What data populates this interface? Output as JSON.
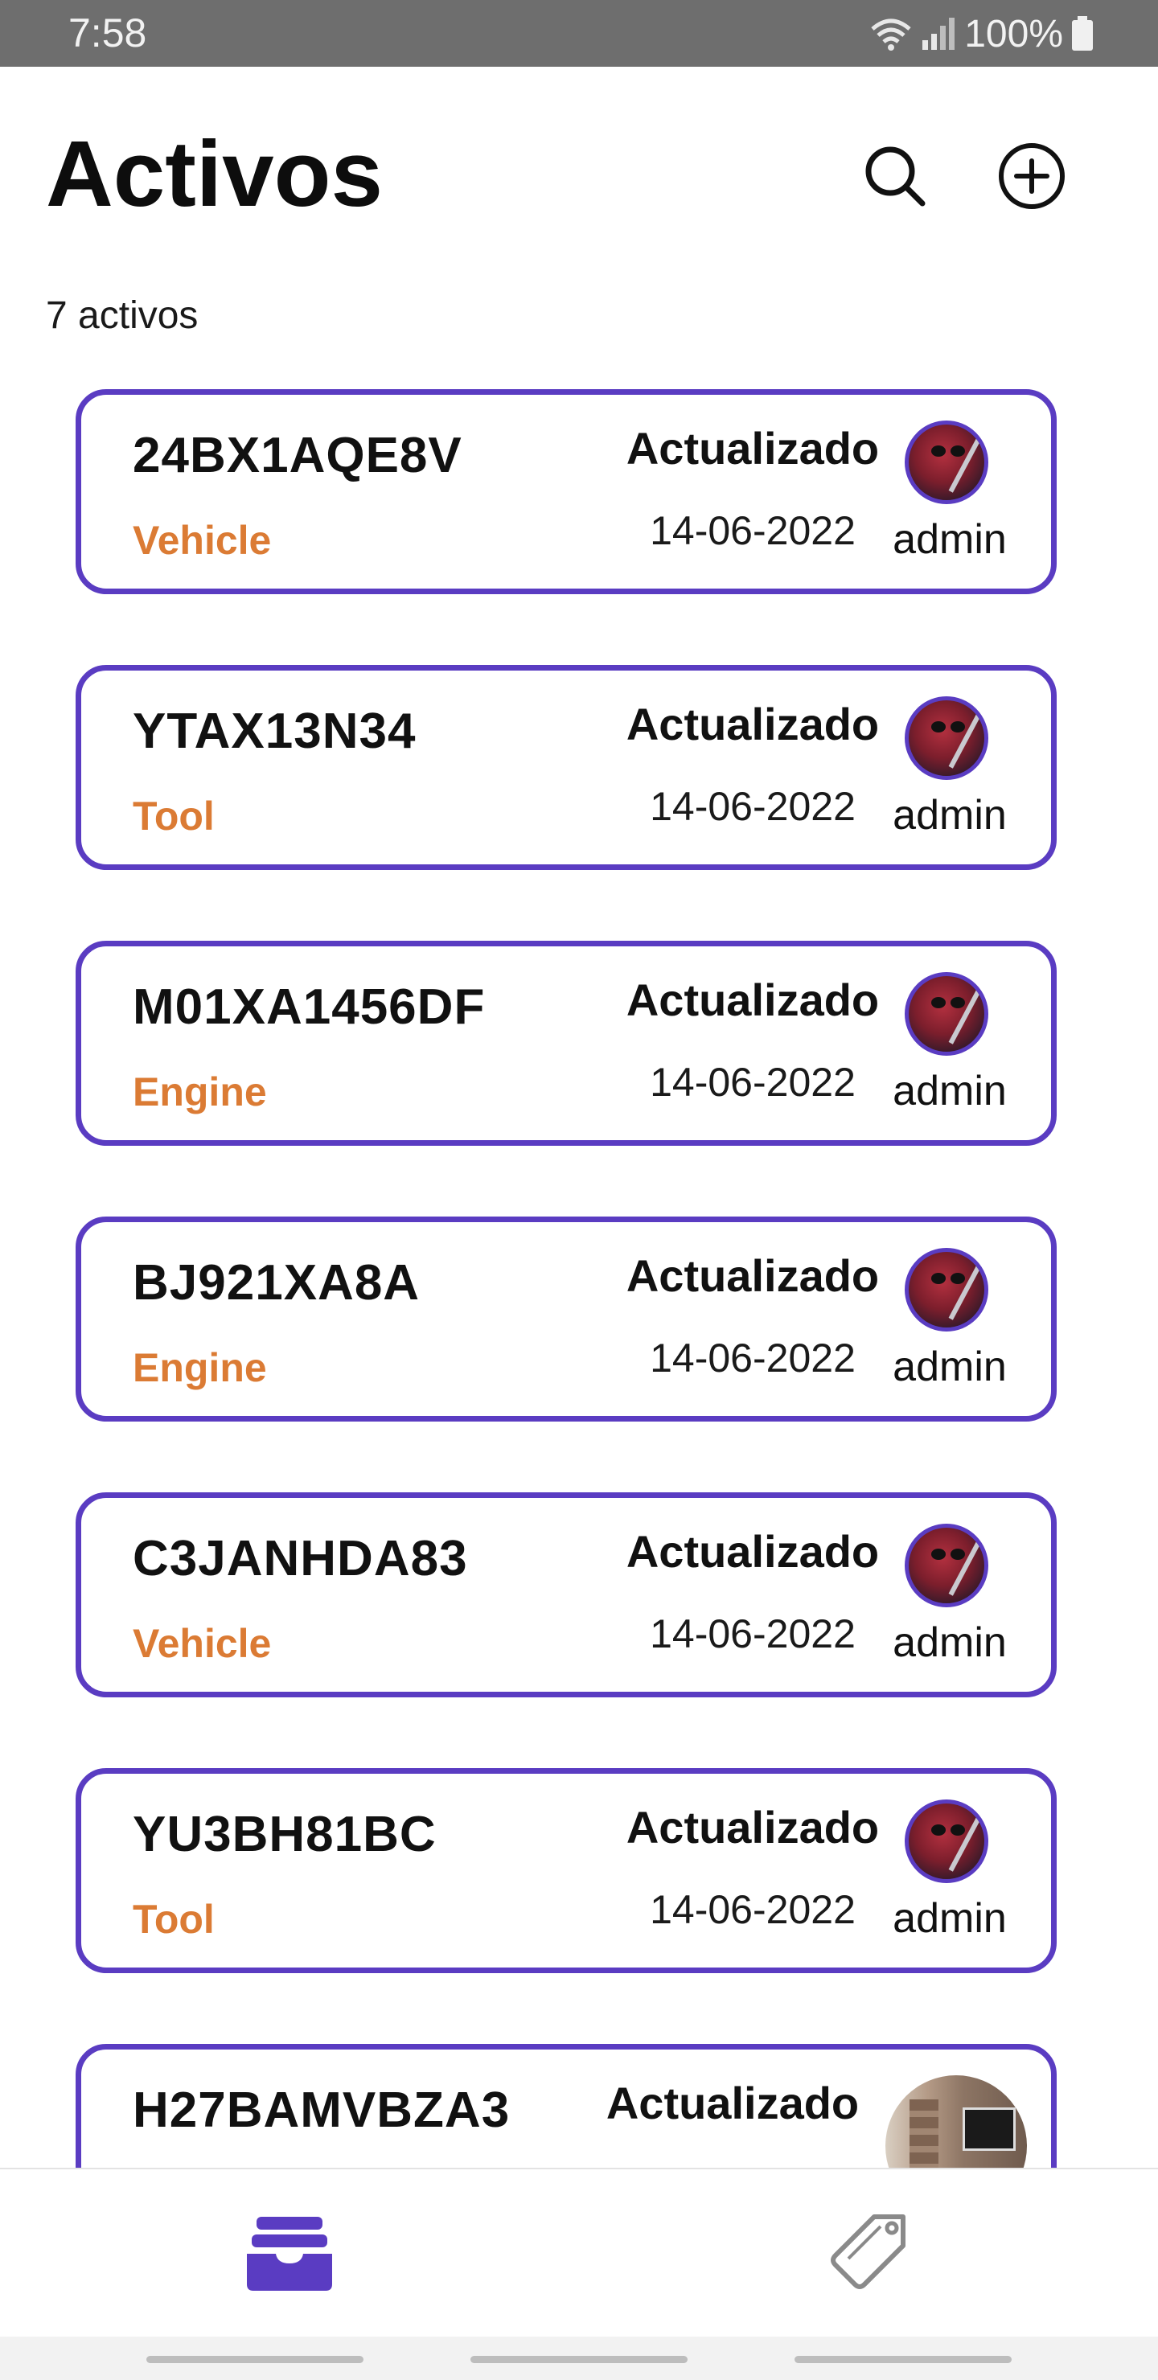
{
  "status_bar": {
    "time": "7:58",
    "battery": "100%"
  },
  "header": {
    "title": "Activos"
  },
  "summary": {
    "count_text": "7 activos"
  },
  "colors": {
    "accent": "#5a3cc2",
    "type_label": "#db7b34"
  },
  "assets": [
    {
      "code": "24BX1AQE8V",
      "type": "Vehicle",
      "status": "Actualizado",
      "date": "14-06-2022",
      "user": "admin"
    },
    {
      "code": "YTAX13N34",
      "type": "Tool",
      "status": "Actualizado",
      "date": "14-06-2022",
      "user": "admin"
    },
    {
      "code": "M01XA1456DF",
      "type": "Engine",
      "status": "Actualizado",
      "date": "14-06-2022",
      "user": "admin"
    },
    {
      "code": "BJ921XA8A",
      "type": "Engine",
      "status": "Actualizado",
      "date": "14-06-2022",
      "user": "admin"
    },
    {
      "code": "C3JANHDA83",
      "type": "Vehicle",
      "status": "Actualizado",
      "date": "14-06-2022",
      "user": "admin"
    },
    {
      "code": "YU3BH81BC",
      "type": "Tool",
      "status": "Actualizado",
      "date": "14-06-2022",
      "user": "admin"
    },
    {
      "code": "H27BAMVBZA3",
      "status": "Actualizado"
    }
  ],
  "icons": {
    "search": "search-icon",
    "add": "add-circle-icon",
    "inbox": "inbox-icon",
    "tags": "tag-icon"
  }
}
